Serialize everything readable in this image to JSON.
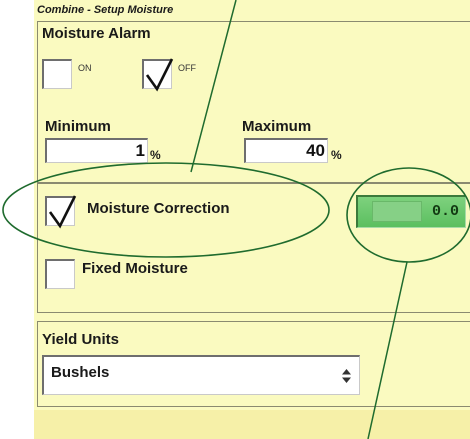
{
  "window": {
    "title": "Combine - Setup Moisture"
  },
  "alarm": {
    "heading": "Moisture Alarm",
    "on_label": "ON",
    "off_label": "OFF",
    "on_checked": false,
    "off_checked": true,
    "minimum_label": "Minimum",
    "maximum_label": "Maximum",
    "minimum_value": "1",
    "maximum_value": "40",
    "unit": "%"
  },
  "correction": {
    "moisture_correction_label": "Moisture Correction",
    "moisture_correction_checked": true,
    "correction_value": "0.0",
    "fixed_moisture_label": "Fixed Moisture",
    "fixed_moisture_checked": false
  },
  "yield": {
    "heading": "Yield Units",
    "selected_value": "Bushels"
  },
  "colors": {
    "panel_background": "#fafac0",
    "annotation": "#1f6b2e",
    "value_field_green": "#6cc86f"
  }
}
